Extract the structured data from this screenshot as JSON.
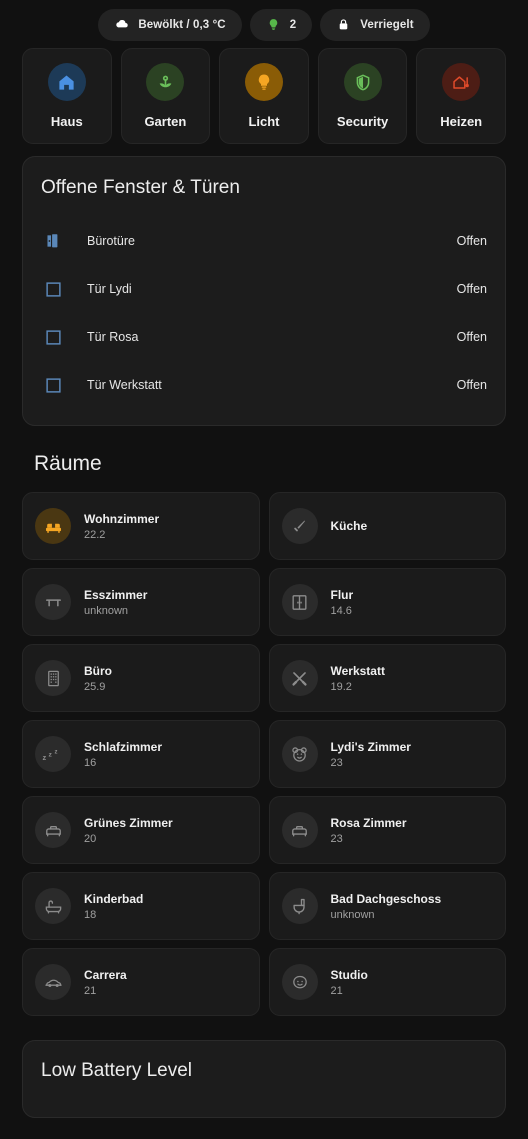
{
  "status_chips": [
    {
      "icon": "cloud-icon",
      "label": "Bewölkt / 0,3 °C",
      "color": "#ffffff"
    },
    {
      "icon": "lightbulb-icon",
      "label": "2",
      "color": "#57b84a"
    },
    {
      "icon": "lock-closed-icon",
      "label": "Verriegelt",
      "color": "#ffffff"
    }
  ],
  "nav_tiles": [
    {
      "icon": "home-icon",
      "label": "Haus",
      "icon_color": "#4a90e2",
      "circle_color": "#1d3a57"
    },
    {
      "icon": "flower-icon",
      "label": "Garten",
      "icon_color": "#6abf5a",
      "circle_color": "#2b4223"
    },
    {
      "icon": "lightbulb-icon",
      "label": "Licht",
      "icon_color": "#f5a623",
      "circle_color": "#8a5c06"
    },
    {
      "icon": "shield-icon",
      "label": "Security",
      "icon_color": "#6abf5a",
      "circle_color": "#2b4223"
    },
    {
      "icon": "house-thermometer-icon",
      "label": "Heizen",
      "icon_color": "#e04a2a",
      "circle_color": "#4d1d15"
    }
  ],
  "openings_card": {
    "title": "Offene Fenster & Türen",
    "rows": [
      {
        "icon": "door-open-icon",
        "name": "Bürotüre",
        "state": "Offen"
      },
      {
        "icon": "window-icon",
        "name": "Tür Lydi",
        "state": "Offen"
      },
      {
        "icon": "window-icon",
        "name": "Tür Rosa",
        "state": "Offen"
      },
      {
        "icon": "window-icon",
        "name": "Tür Werkstatt",
        "state": "Offen"
      }
    ]
  },
  "rooms_section": {
    "title": "Räume",
    "rooms": [
      {
        "icon": "sofa-icon",
        "name": "Wohnzimmer",
        "value": "22.2",
        "active": true
      },
      {
        "icon": "knife-icon",
        "name": "Küche",
        "value": "",
        "active": false
      },
      {
        "icon": "table-icon",
        "name": "Esszimmer",
        "value": "unknown",
        "active": false
      },
      {
        "icon": "wardrobe-icon",
        "name": "Flur",
        "value": "14.6",
        "active": false
      },
      {
        "icon": "building-icon",
        "name": "Büro",
        "value": "25.9",
        "active": false
      },
      {
        "icon": "tools-icon",
        "name": "Werkstatt",
        "value": "19.2",
        "active": false
      },
      {
        "icon": "sleep-zzz-icon",
        "name": "Schlafzimmer",
        "value": "16",
        "active": false
      },
      {
        "icon": "teddy-bear-icon",
        "name": "Lydi's Zimmer",
        "value": "23",
        "active": false
      },
      {
        "icon": "bed-icon",
        "name": "Grünes Zimmer",
        "value": "20",
        "active": false
      },
      {
        "icon": "bed-icon",
        "name": "Rosa Zimmer",
        "value": "23",
        "active": false
      },
      {
        "icon": "bathtub-icon",
        "name": "Kinderbad",
        "value": "18",
        "active": false
      },
      {
        "icon": "toilet-icon",
        "name": "Bad Dachgeschoss",
        "value": "unknown",
        "active": false
      },
      {
        "icon": "car-icon",
        "name": "Carrera",
        "value": "21",
        "active": false
      },
      {
        "icon": "baby-face-icon",
        "name": "Studio",
        "value": "21",
        "active": false
      }
    ]
  },
  "battery_card": {
    "title": "Low Battery Level"
  },
  "colors": {
    "page_background": "#111111",
    "card_background": "#1c1c1c",
    "chip_background": "#232323",
    "accent_amber": "#f5a623",
    "accent_blue": "#4a90e2",
    "opening_icon_blue": "#5a87b8"
  }
}
